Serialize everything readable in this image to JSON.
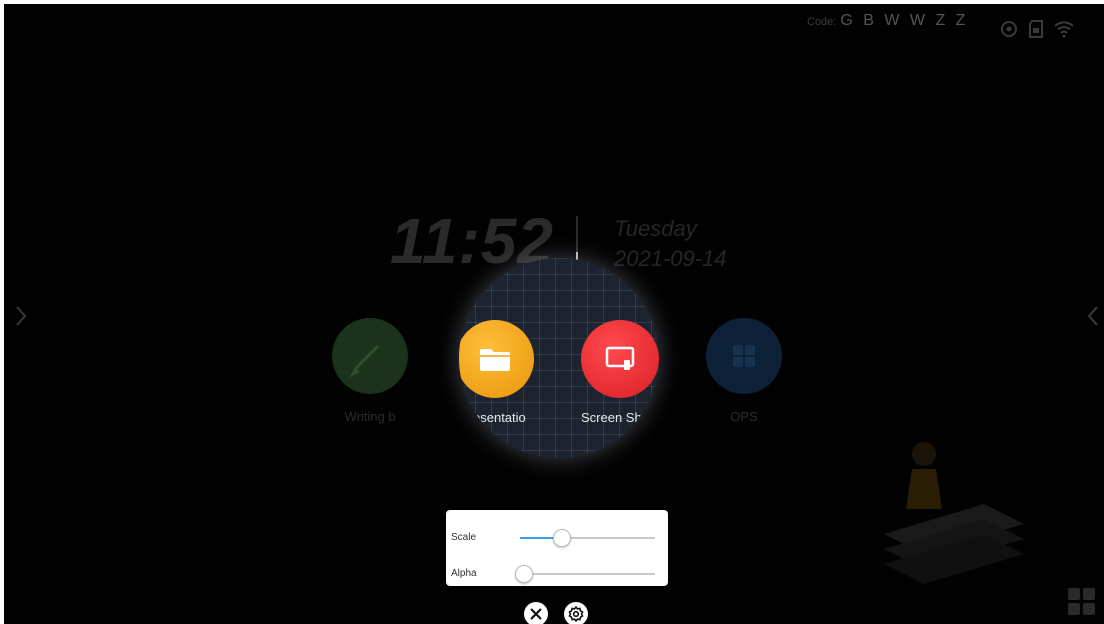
{
  "status_bar": {
    "code_label": "Code:",
    "code_value": "G B W W Z Z",
    "icons": [
      "cast-icon",
      "sd-card-icon",
      "wifi-icon"
    ]
  },
  "clock": {
    "time": "11:52",
    "day": "Tuesday",
    "date": "2021-09-14"
  },
  "apps": [
    {
      "label": "Writing b",
      "icon": "pen-icon",
      "color": "#1f3d1f"
    },
    {
      "label": "Presentatio",
      "icon": "folder-icon",
      "color": "#f2a20b"
    },
    {
      "label": "Screen Sh",
      "icon": "screen-share-icon",
      "color": "#e8282d"
    },
    {
      "label": "OPS",
      "icon": "windows-icon",
      "color": "#0f2a44"
    }
  ],
  "panel": {
    "scale_label": "Scale",
    "scale_value": 0.28,
    "alpha_label": "Alpha",
    "alpha_value": 0.0
  },
  "controls": {
    "close_icon": "close-icon",
    "settings_icon": "gear-icon"
  },
  "colors": {
    "slider_active": "#3aa0e8",
    "background": "#020202"
  }
}
